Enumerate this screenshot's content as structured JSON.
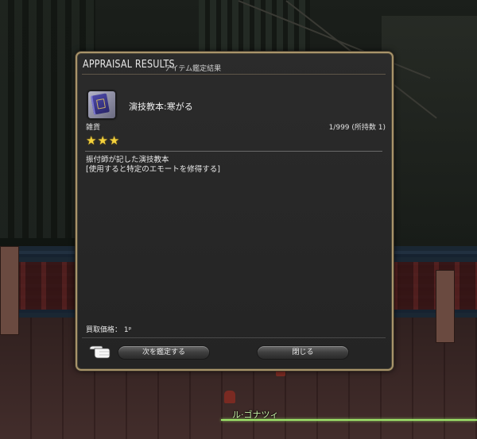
{
  "world": {
    "nameplate": "ル·ゴナツィ",
    "nameplate_color": "#9ee66a"
  },
  "dialog": {
    "title_main": "APPRAISAL RESULTS",
    "title_sub": "アイテム鑑定結果",
    "item": {
      "icon": "book-icon",
      "name": "演技教本:寒がる",
      "category": "雑貨",
      "stock": "1/999 (所持数 1)",
      "stars": "★★★",
      "star_count": 3
    },
    "description": [
      "振付師が記した演技教本",
      "[使用すると特定のエモートを修得する]"
    ],
    "price": "買取価格： 1ᵖ",
    "buttons": {
      "next": "次を鑑定する",
      "close": "閉じる"
    },
    "cursor_icon": "pointing-hand-icon",
    "frame_color": "#a8946a"
  }
}
